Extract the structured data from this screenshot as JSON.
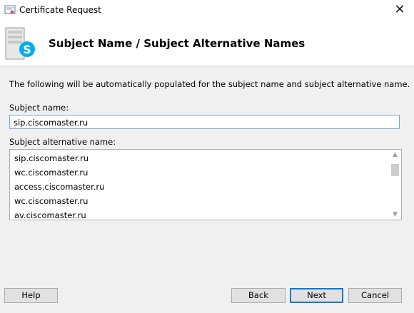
{
  "window": {
    "title": "Certificate Request",
    "close_glyph": "✕"
  },
  "header": {
    "title": "Subject Name / Subject Alternative Names",
    "icon": "server-skype-icon"
  },
  "main": {
    "description": "The following will be automatically populated for the subject name and subject alternative name.",
    "subject_label": "Subject name:",
    "subject_value": "sip.ciscomaster.ru",
    "san_label": "Subject alternative name:",
    "san_items": [
      "sip.ciscomaster.ru",
      "wc.ciscomaster.ru",
      "access.ciscomaster.ru",
      "wc.ciscomaster.ru",
      "av.ciscomaster.ru"
    ]
  },
  "buttons": {
    "help": "Help",
    "back": "Back",
    "next": "Next",
    "cancel": "Cancel"
  },
  "colors": {
    "accent": "#0078d7",
    "skype_blue": "#00aff0"
  }
}
